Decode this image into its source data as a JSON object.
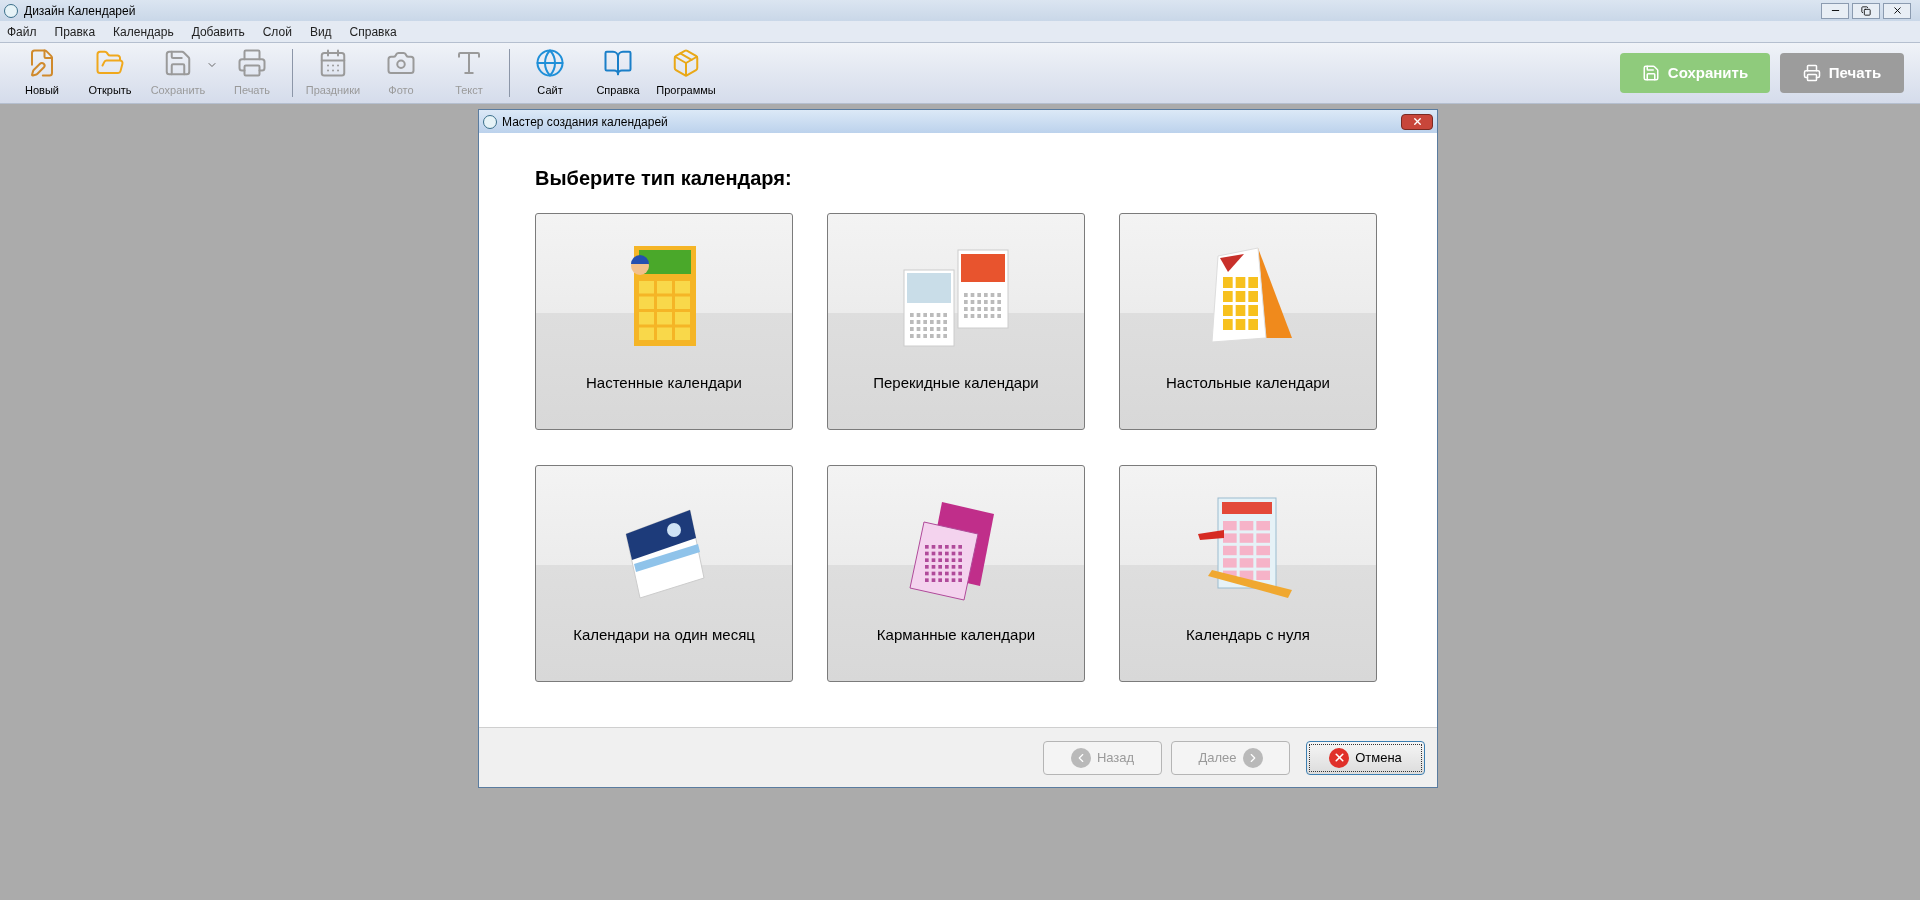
{
  "window": {
    "title": "Дизайн Календарей"
  },
  "menu": [
    "Файл",
    "Правка",
    "Календарь",
    "Добавить",
    "Слой",
    "Вид",
    "Справка"
  ],
  "toolbar": [
    {
      "label": "Новый",
      "disabled": false,
      "dropdown": false
    },
    {
      "label": "Открыть",
      "disabled": false,
      "dropdown": false
    },
    {
      "label": "Сохранить",
      "disabled": true,
      "dropdown": true
    },
    {
      "label": "Печать",
      "disabled": true,
      "dropdown": false
    },
    {
      "label": "Праздники",
      "disabled": true,
      "dropdown": false
    },
    {
      "label": "Фото",
      "disabled": true,
      "dropdown": false
    },
    {
      "label": "Текст",
      "disabled": true,
      "dropdown": false
    },
    {
      "label": "Сайт",
      "disabled": false,
      "dropdown": false
    },
    {
      "label": "Справка",
      "disabled": false,
      "dropdown": false
    },
    {
      "label": "Программы",
      "disabled": false,
      "dropdown": false
    }
  ],
  "action_buttons": [
    {
      "label": "Сохранить",
      "kind": "save"
    },
    {
      "label": "Печать",
      "kind": "print"
    }
  ],
  "dialog": {
    "title": "Мастер создания календарей",
    "heading": "Выберите тип календаря:",
    "cards": [
      {
        "label": "Настенные календари"
      },
      {
        "label": "Перекидные календари"
      },
      {
        "label": "Настольные календари"
      },
      {
        "label": "Календари на один месяц"
      },
      {
        "label": "Карманные календари"
      },
      {
        "label": "Календарь с нуля"
      }
    ],
    "buttons": [
      {
        "label": "Назад",
        "kind": "back",
        "disabled": true,
        "focused": false
      },
      {
        "label": "Далее",
        "kind": "next",
        "disabled": true,
        "focused": false
      },
      {
        "label": "Отмена",
        "kind": "cancel",
        "disabled": false,
        "focused": true
      }
    ]
  }
}
